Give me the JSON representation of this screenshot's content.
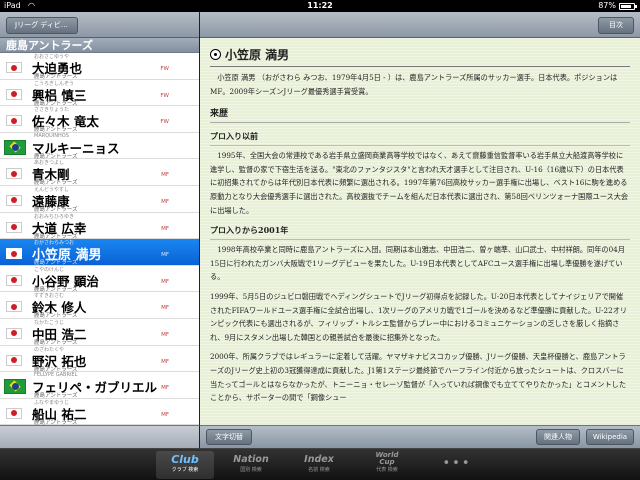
{
  "status_bar": {
    "carrier": "iPad",
    "wifi_icon": "wifi-icon",
    "time": "11:22",
    "battery_text": "87%",
    "battery_level": 0.87
  },
  "master": {
    "back_label": "Jリーグ ディビジ...",
    "header": "鹿島アントラーズ",
    "players": [
      {
        "kana": "おおさこゆうや",
        "name": "大迫勇也",
        "club": "鹿島アントラーズ",
        "pos": "FW",
        "flag": "jp",
        "selected": false
      },
      {
        "kana": "こうろぎしんぞう",
        "name": "興梠 慎三",
        "club": "鹿島アントラーズ",
        "pos": "FW",
        "flag": "jp",
        "selected": false
      },
      {
        "kana": "ささきりょうた",
        "name": "佐々木 竜太",
        "club": "鹿島アントラーズ",
        "pos": "FW",
        "flag": "jp",
        "selected": false
      },
      {
        "kana": "MARQUINHOS",
        "name": "マルキーニョス",
        "club": "鹿島アントラーズ",
        "pos": "",
        "flag": "br",
        "selected": false
      },
      {
        "kana": "あおきつよし",
        "name": "青木剛",
        "club": "鹿島アントラーズ",
        "pos": "MF",
        "flag": "jp",
        "selected": false
      },
      {
        "kana": "えんどうやすし",
        "name": "遠藤康",
        "club": "鹿島アントラーズ",
        "pos": "MF",
        "flag": "jp",
        "selected": false
      },
      {
        "kana": "おおみちひろゆき",
        "name": "大道 広幸",
        "club": "鹿島アントラーズ",
        "pos": "MF",
        "flag": "jp",
        "selected": false
      },
      {
        "kana": "おがさわらみつお",
        "name": "小笠原 満男",
        "club": "鹿島アントラーズ",
        "pos": "MF",
        "flag": "jp",
        "selected": true
      },
      {
        "kana": "こやのけんじ",
        "name": "小谷野 顕治",
        "club": "鹿島アントラーズ",
        "pos": "MF",
        "flag": "jp",
        "selected": false
      },
      {
        "kana": "すずきおさむ",
        "name": "鈴木 修人",
        "club": "鹿島アントラーズ",
        "pos": "MF",
        "flag": "jp",
        "selected": false
      },
      {
        "kana": "なかたこうじ",
        "name": "中田 浩二",
        "club": "鹿島アントラーズ",
        "pos": "MF",
        "flag": "jp",
        "selected": false
      },
      {
        "kana": "のざわたくや",
        "name": "野沢 拓也",
        "club": "鹿島アントラーズ",
        "pos": "MF",
        "flag": "jp",
        "selected": false
      },
      {
        "kana": "FELLYPE GABRIEL",
        "name": "フェリペ・ガブリエル",
        "club": "鹿島アントラーズ",
        "pos": "MF",
        "flag": "br",
        "selected": false
      },
      {
        "kana": "ふなやまゆうじ",
        "name": "船山 祐二",
        "club": "鹿島アントラーズ",
        "pos": "MF",
        "flag": "jp",
        "selected": false
      },
      {
        "kana": "",
        "name": "本山 雅志",
        "club": "",
        "pos": "",
        "flag": "jp",
        "selected": false
      }
    ]
  },
  "detail": {
    "toc_label": "目次",
    "title": "小笠原 満男",
    "intro": "小笠原 満男 （おがさわら みつお、1979年4月5日 - ）は、鹿島アントラーズ所属のサッカー選手。日本代表。ポジションはMF。2009年シーズンJリーグ最優秀選手賞受賞。",
    "section_career": "来歴",
    "sub_before_pro": "プロ入り以前",
    "para_before_pro": "1995年、全国大会の常連校である岩手県立盛岡商業高等学校ではなく、あえて齋藤重信監督率いる岩手県立大船渡高等学校に進学し、監督の家で下宿生活を送る。\"東北のファンタジスタ\"と言われ天才選手として注目され、U-16（16歳以下）の日本代表に初招集されてからは年代別日本代表に頻繁に選出される。1997年第76回高校サッカー選手権に出場し、ベスト16に駒を進める原動力となり大会優秀選手に選出された。高校選抜でチームを組んだ日本代表に選出され、第58回ベリンツォーナ国際ユース大会に出場した。",
    "sub_after_pro": "プロ入りから2001年",
    "para_after_pro_1": "1998年高校卒業と同時に鹿島アントラーズに入団。同期は本山雅志、中田浩二、曽ヶ端準、山口武士、中村祥朗。同年の04月15日に行われたガンバ大阪戦で1リーグデビューを果たした。U-19日本代表としてAFCユース選手権に出場し準優勝を遂げている。",
    "para_after_pro_2": "1999年、5月5日のジュビロ磐田戦でヘディングシュートでJリーグ初得点を記録した。U-20日本代表としてナイジェリアで開催されたFIFAワールドユース選手権に全試合出場し、1次リーグのアメリカ戦で1ゴールを決めるなど準優勝に貢献した。U-22オリンピック代表にも選出されるが、フィリップ・トルシエ監督からプレー中におけるコミュニケーションの乏しさを厳しく指摘され、9月にスタメン出場した韓国との親善試合を最後に招集外となった。",
    "para_after_pro_3": "2000年、所属クラブではレギュラーに定着して活躍。ヤマザキナビスコカップ優勝、Jリーグ優勝、天皇杯優勝と、鹿島アントラーズのJリーグ史上初の3冠獲得達成に貢献した。J1第1ステージ最終節でハーフライン付近から放ったシュートは、クロスバーに当たってゴールとはならなかったが、トニーニョ・セレーゾ監督が「入っていれば鋼像でも立ててやりたかった」とコメントしたことから、サポーターの間で「鋼像シュー"
  },
  "toolbar": {
    "font_toggle": "文字切替",
    "related": "関連人物",
    "wikipedia": "Wikipedia"
  },
  "tabbar": {
    "tabs": [
      {
        "label": "Club",
        "sub": "クラブ 検索",
        "active": true
      },
      {
        "label": "Nation",
        "sub": "国別 検索",
        "active": false
      },
      {
        "label": "Index",
        "sub": "名前 検索",
        "active": false
      },
      {
        "label": "World",
        "label2": "Cup",
        "sub": "代表 検索",
        "active": false
      },
      {
        "label": "•••",
        "sub": "",
        "active": false
      }
    ]
  },
  "colors": {
    "selection": "#0a6ee0",
    "article_bg": "#e9f0d8",
    "japan_red": "#d01c26",
    "brazil_green": "#1e9b3a"
  }
}
